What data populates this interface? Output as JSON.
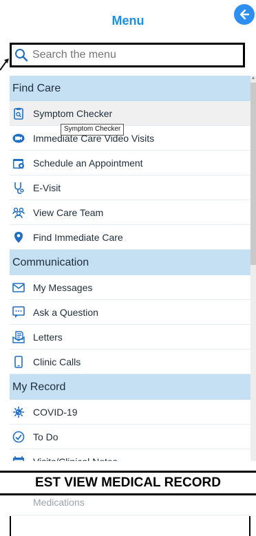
{
  "header": {
    "title": "Menu"
  },
  "search": {
    "placeholder": "Search the menu"
  },
  "sections": [
    {
      "title": "Find Care",
      "items": [
        {
          "label": "Symptom Checker",
          "icon": "clipboard-search-icon"
        },
        {
          "label": "Immediate Care Video Visits",
          "icon": "video-camera-icon"
        },
        {
          "label": "Schedule an Appointment",
          "icon": "calendar-plus-icon"
        },
        {
          "label": "E-Visit",
          "icon": "stethoscope-icon"
        },
        {
          "label": "View Care Team",
          "icon": "care-team-icon"
        },
        {
          "label": "Find Immediate Care",
          "icon": "location-pin-icon"
        }
      ]
    },
    {
      "title": "Communication",
      "items": [
        {
          "label": "My Messages",
          "icon": "envelope-icon"
        },
        {
          "label": "Ask a Question",
          "icon": "chat-bubble-icon"
        },
        {
          "label": "Letters",
          "icon": "letter-document-icon"
        },
        {
          "label": "Clinic Calls",
          "icon": "mobile-phone-icon"
        }
      ]
    },
    {
      "title": "My Record",
      "items": [
        {
          "label": "COVID-19",
          "icon": "virus-icon"
        },
        {
          "label": "To Do",
          "icon": "checkmark-circle-icon"
        },
        {
          "label": "Visits/Clinical Notes",
          "icon": "calendar-icon"
        }
      ]
    }
  ],
  "tooltip": "Symptom Checker",
  "banner": "EST VIEW MEDICAL RECORD",
  "partial_item": "Medications",
  "colors": {
    "accent": "#1a8fe3",
    "section_bg": "#c5dff3",
    "icon_blue": "#1e6fc4"
  }
}
